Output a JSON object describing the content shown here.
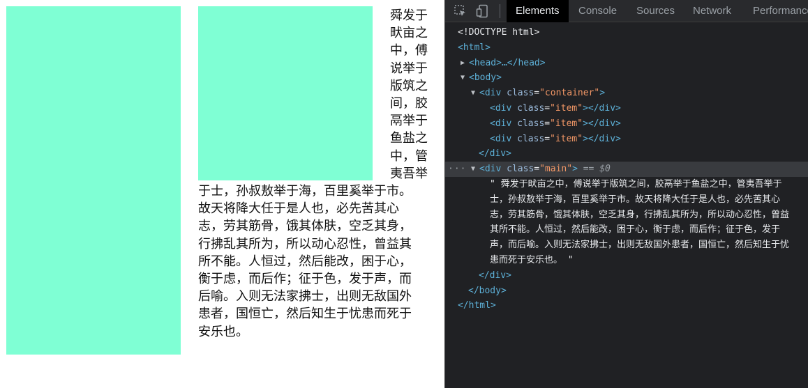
{
  "page": {
    "paragraph_lines_narrow": [
      "舜发于",
      "畎亩之",
      "中，傅",
      "说举于",
      "版筑之",
      "间，胶",
      "鬲举于",
      "鱼盐之",
      "中，管",
      "夷吾举"
    ],
    "paragraph_lines_wide": [
      "于士，孙叔敖举于海，百里奚举于市。",
      "故天将降大任于是人也，必先苦其心",
      "志，劳其筋骨，饿其体肤，空乏其身，",
      "行拂乱其所为，所以动心忍性，曾益其",
      "所不能。人恒过，然后能改，困于心，",
      "衡于虑，而后作；征于色，发于声，而",
      "后喻。入则无法家拂士，出则无敌国外",
      "患者，国恒亡，然后知生于忧患而死于",
      "安乐也。"
    ],
    "box_color": "#7fffd4"
  },
  "devtools": {
    "tabs": [
      "Elements",
      "Console",
      "Sources",
      "Network",
      "Performance"
    ],
    "active_tab": "Elements",
    "dom": {
      "doctype": "<!DOCTYPE html>",
      "html_open": "<html>",
      "head": "<head>…</head>",
      "body_open": "<body>",
      "container_tag": "div",
      "container_attr": "class",
      "container_value": "\"container\"",
      "item_tag": "div",
      "item_attr": "class",
      "item_value": "\"item\"",
      "div_close": "</div>",
      "main_tag": "div",
      "main_attr": "class",
      "main_value": "\"main\"",
      "selected_marker": "== $0",
      "ellipsis": "···",
      "text_node_lines": [
        "\" 舜发于畎亩之中，傅说举于版筑之间，胶鬲举于鱼盐之中，管夷吾举于",
        "士，孙叔敖举于海，百里奚举于市。故天将降大任于是人也，必先苦其心",
        "志，劳其筋骨，饿其体肤，空乏其身，行拂乱其所为，所以动心忍性，曾益",
        "其所不能。人恒过，然后能改，困于心，衡于虑，而后作；征于色，发于",
        "声，而后喻。入则无法家拂士，出则无敌国外患者，国恒亡，然后知生于忧",
        "患而死于安乐也。 \""
      ],
      "body_close": "</body>",
      "html_close": "</html>"
    },
    "colors": {
      "background": "#202124",
      "toolbar": "#292a2d",
      "tag": "#5db0d7",
      "attr_name": "#9bbbdc",
      "attr_value": "#f29766",
      "selected_row": "#393b3f"
    },
    "icons": [
      "inspect-element-icon",
      "device-toolbar-icon"
    ]
  }
}
